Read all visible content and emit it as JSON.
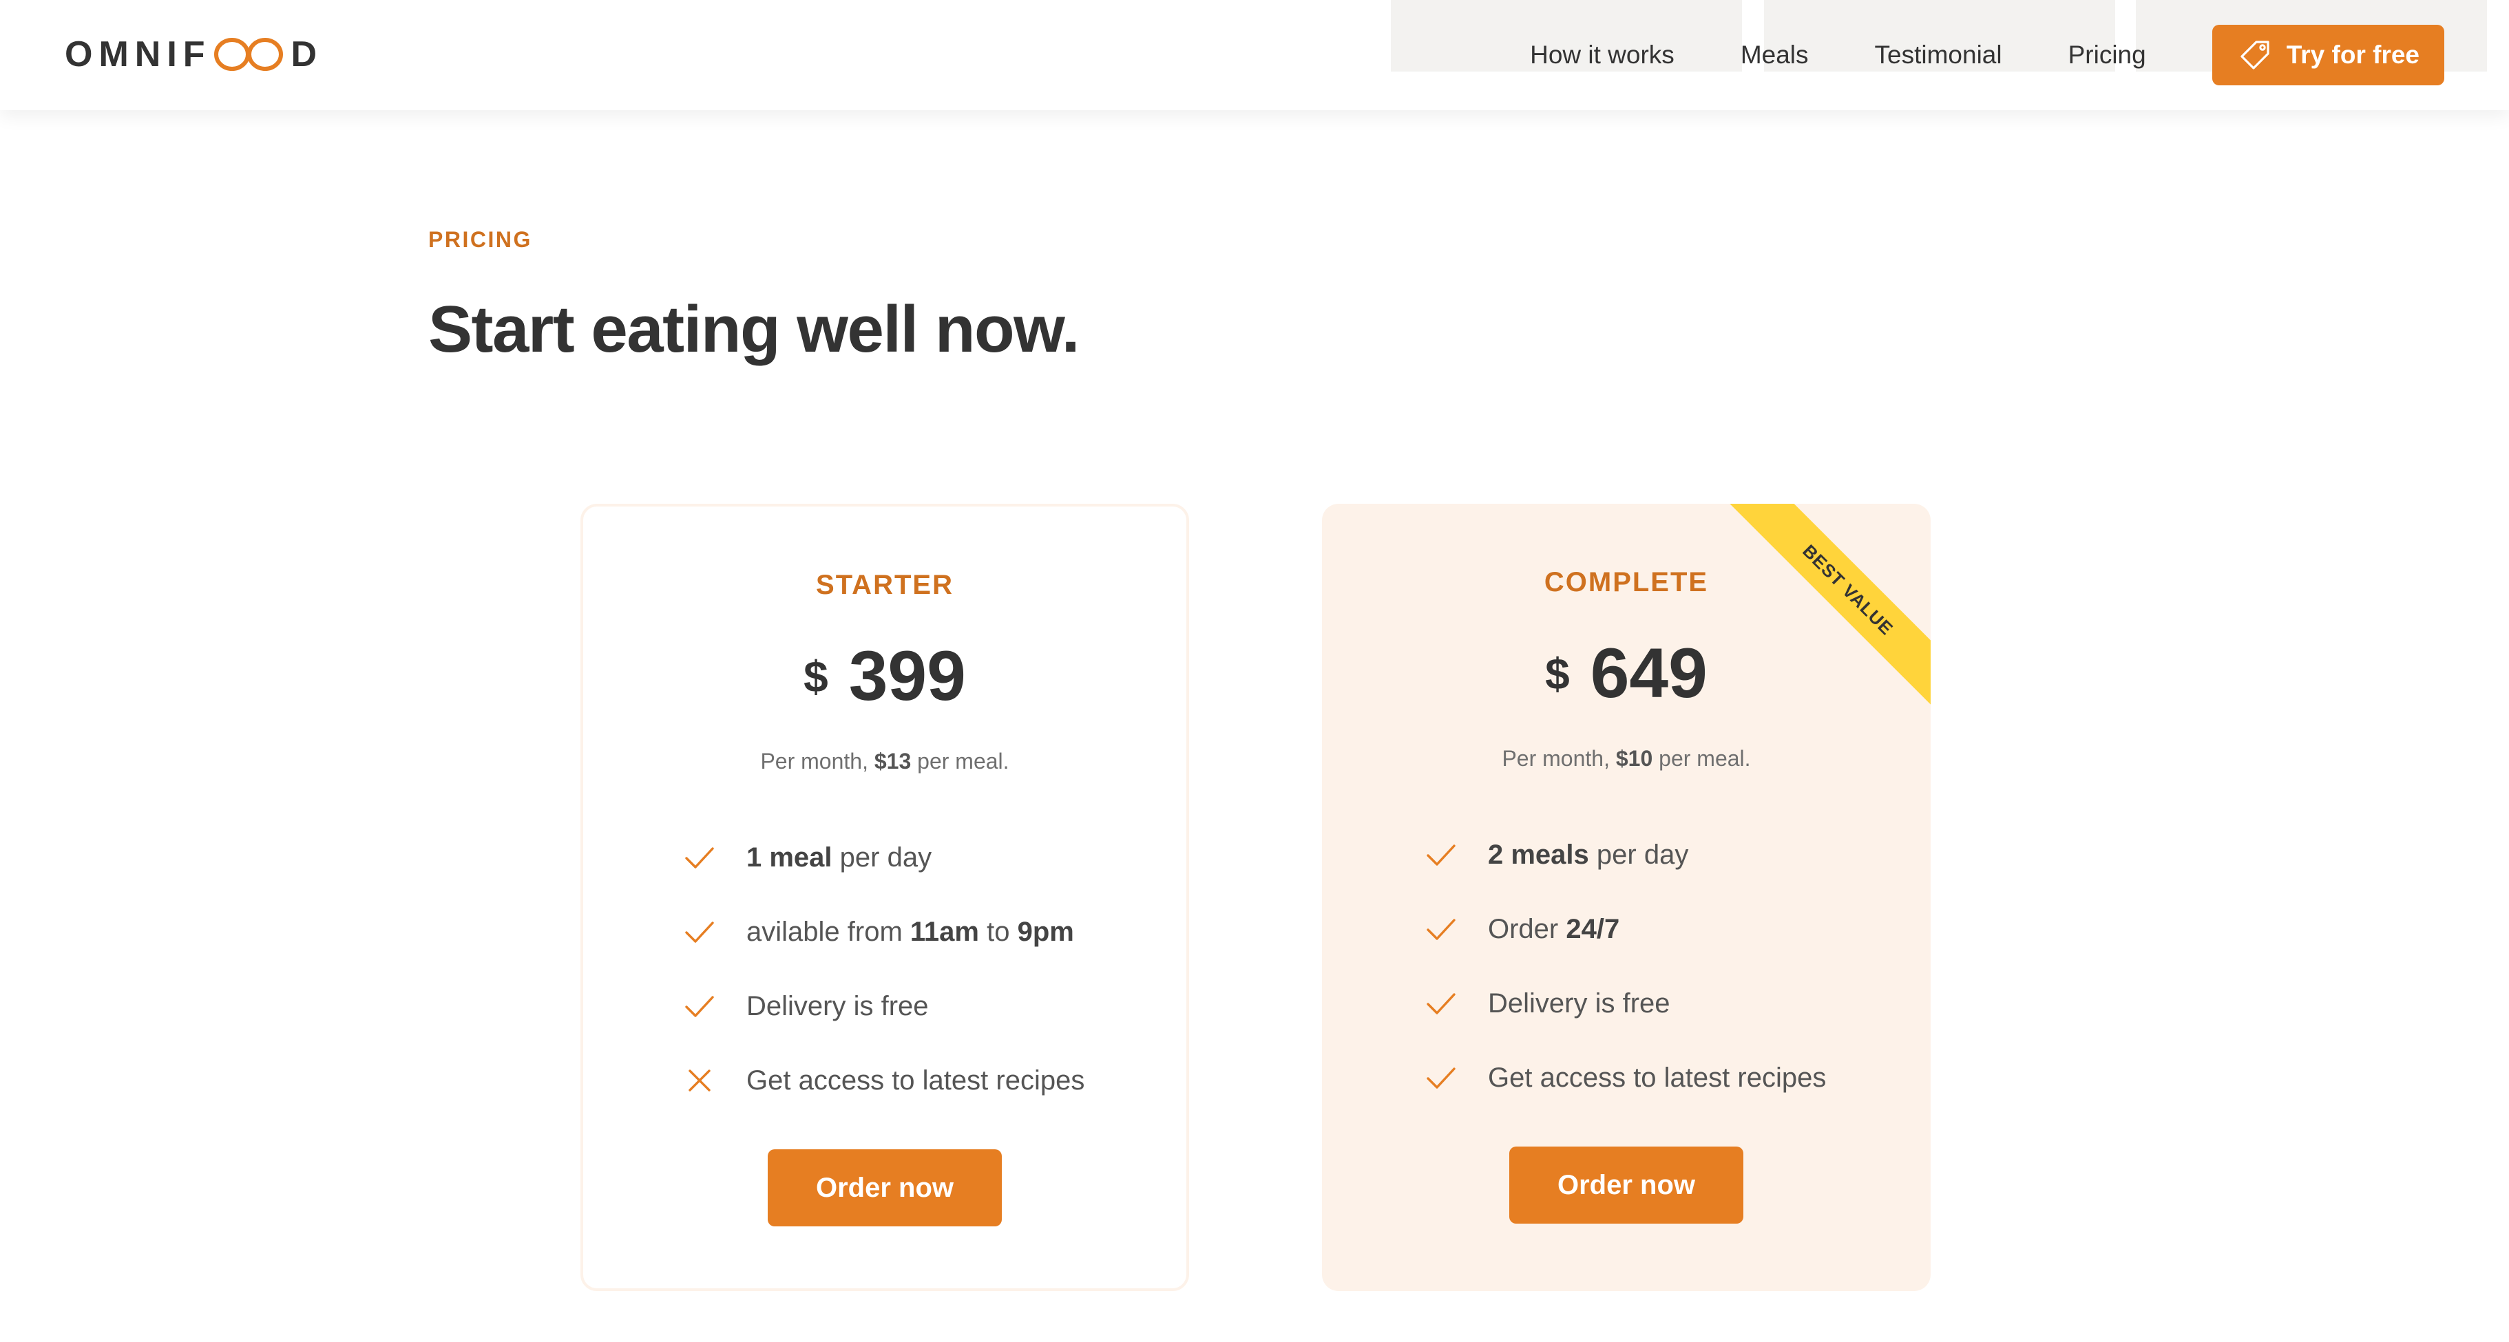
{
  "header": {
    "logo_text_left": "OMNIF",
    "logo_text_right": "D",
    "nav": {
      "how_it_works": "How it works",
      "meals": "Meals",
      "testimonial": "Testimonial",
      "pricing": "Pricing",
      "cta": "Try for free"
    }
  },
  "section": {
    "subheading": "PRICING",
    "heading": "Start eating well now."
  },
  "plans": [
    {
      "name": "STARTER",
      "currency": "$",
      "price": "399",
      "note": {
        "prefix": "Per month, ",
        "meal_price": "$13",
        "suffix": " per meal."
      },
      "features": [
        {
          "icon": "check-icon",
          "included": true,
          "parts": {
            "a": "1 meal",
            "b": " per day",
            "c": "",
            "d": "",
            "e": ""
          }
        },
        {
          "icon": "check-icon",
          "included": true,
          "parts": {
            "a": "",
            "b": "avilable from ",
            "c": "11am",
            "d": " to ",
            "e": "9pm"
          }
        },
        {
          "icon": "check-icon",
          "included": true,
          "parts": {
            "a": "",
            "b": "Delivery is free",
            "c": "",
            "d": "",
            "e": ""
          }
        },
        {
          "icon": "close-icon",
          "included": false,
          "parts": {
            "a": "",
            "b": "Get access to latest recipes",
            "c": "",
            "d": "",
            "e": ""
          }
        }
      ],
      "button": "Order now"
    },
    {
      "name": "COMPLETE",
      "currency": "$",
      "price": "649",
      "ribbon": "BEST VALUE",
      "note": {
        "prefix": "Per month, ",
        "meal_price": "$10",
        "suffix": " per meal."
      },
      "features": [
        {
          "icon": "check-icon",
          "included": true,
          "parts": {
            "a": "2 meals",
            "b": " per day",
            "c": "",
            "d": "",
            "e": ""
          }
        },
        {
          "icon": "check-icon",
          "included": true,
          "parts": {
            "a": "",
            "b": "Order ",
            "c": "24/7",
            "d": "",
            "e": ""
          }
        },
        {
          "icon": "check-icon",
          "included": true,
          "parts": {
            "a": "",
            "b": "Delivery is free",
            "c": "",
            "d": "",
            "e": ""
          }
        },
        {
          "icon": "check-icon",
          "included": true,
          "parts": {
            "a": "",
            "b": "Get access to latest recipes",
            "c": "",
            "d": "",
            "e": ""
          }
        }
      ],
      "button": "Order now"
    }
  ],
  "colors": {
    "accent": "#e67e22",
    "accent_dark": "#cf711f",
    "tint": "#fdf2e9",
    "ribbon": "#ffd43b",
    "heading": "#333333",
    "text": "#555555"
  }
}
